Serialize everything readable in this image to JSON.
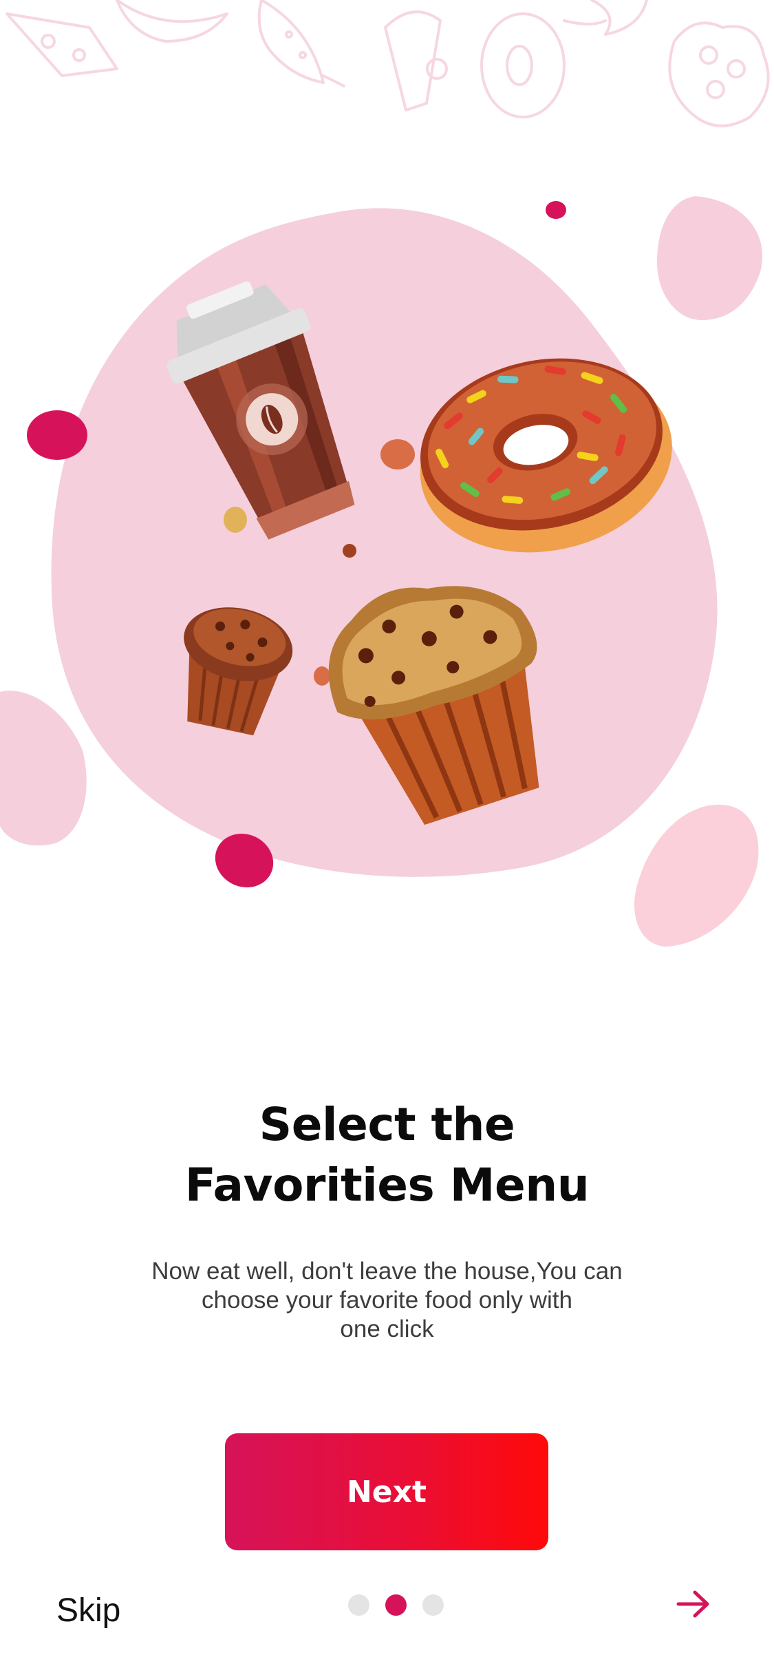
{
  "onboarding": {
    "title_line1": "Select the",
    "title_line2": "Favorities Menu",
    "subtitle_line1": "Now eat well, don't leave the house,You can",
    "subtitle_line2": "choose your favorite food only with",
    "subtitle_line3": "one click",
    "next_label": "Next",
    "skip_label": "Skip",
    "current_page": 2,
    "total_pages": 3
  },
  "colors": {
    "accent": "#d6135a",
    "button_gradient_start": "#d6135a",
    "button_gradient_end": "#ff0a0a",
    "hero_blob": "#f5cfdc",
    "dot_inactive": "#e4e4e4"
  },
  "icons": {
    "next": "arrow-right-icon",
    "illustration": [
      "coffee-cup-icon",
      "donut-icon",
      "muffin-small-icon",
      "muffin-large-icon"
    ]
  }
}
